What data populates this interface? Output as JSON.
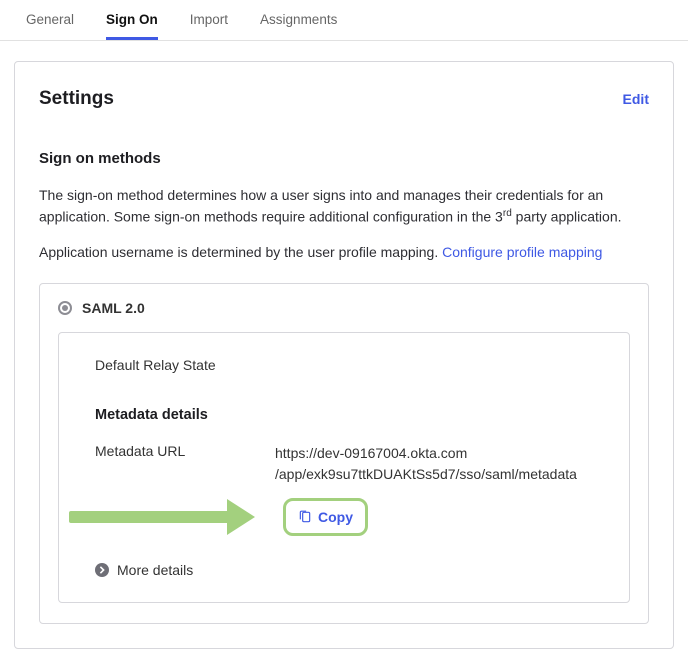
{
  "tabs": {
    "general": "General",
    "sign_on": "Sign On",
    "import": "Import",
    "assignments": "Assignments",
    "active": "sign_on"
  },
  "settings": {
    "title": "Settings",
    "edit": "Edit"
  },
  "signon": {
    "heading": "Sign on methods",
    "desc_pre": "The sign-on method determines how a user signs into and manages their credentials for an application. Some sign-on methods require additional configuration in the 3",
    "desc_sup": "rd",
    "desc_post": " party application.",
    "username_text": "Application username is determined by the user profile mapping. ",
    "configure_link": "Configure profile mapping"
  },
  "saml": {
    "radio_label": "SAML 2.0",
    "relay_label": "Default Relay State",
    "metadata_heading": "Metadata details",
    "metadata_url_label": "Metadata URL",
    "metadata_url_line1": "https://dev-09167004.okta.com",
    "metadata_url_line2": "/app/exk9su7ttkDUAKtSs5d7/sso/saml/metadata",
    "copy_label": "Copy",
    "more_details": "More details"
  }
}
